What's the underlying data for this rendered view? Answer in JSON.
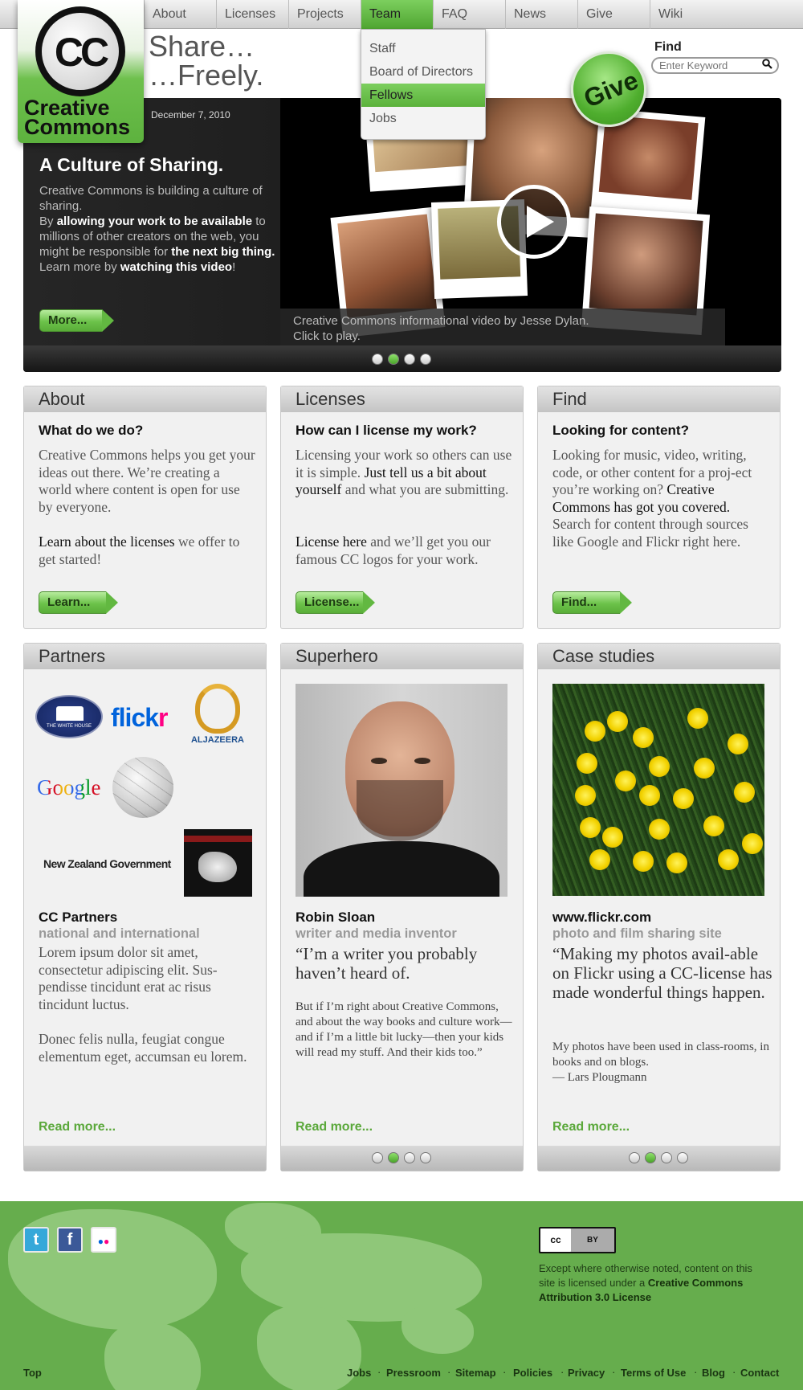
{
  "nav": {
    "items": [
      {
        "label": "About"
      },
      {
        "label": "Licenses"
      },
      {
        "label": "Projects"
      },
      {
        "label": "Team"
      },
      {
        "label": "FAQ"
      },
      {
        "label": "News"
      },
      {
        "label": "Give"
      },
      {
        "label": "Wiki"
      }
    ],
    "active": "Team",
    "active_color": "#5bb23b"
  },
  "logo": {
    "mark": "CC",
    "line1": "Creative",
    "line2": "Commons"
  },
  "tagline": {
    "line1": "Share…",
    "line2": "…Freely."
  },
  "team_menu": {
    "items": [
      {
        "label": "Staff"
      },
      {
        "label": "Board of Directors"
      },
      {
        "label": "Fellows"
      },
      {
        "label": "Jobs"
      }
    ],
    "highlighted": "Fellows"
  },
  "search": {
    "label": "Find",
    "placeholder": "Enter Keyword",
    "icon": "search-icon"
  },
  "give_badge": {
    "label": "Give"
  },
  "hero": {
    "date": "December 7, 2010",
    "title": "A Culture of Sharing.",
    "body": {
      "p1": "Creative Commons is building a culture of sharing.",
      "p2_pre": "By ",
      "p2_bold": "allowing your work to be available",
      "p2_mid": " to millions of other creators on the web, you might be responsible for ",
      "p2_bold2": "the next big thing.",
      "p3_pre": "Learn more by ",
      "p3_bold": "watching this video",
      "p3_post": "!"
    },
    "button": "More...",
    "video_caption_1": "Creative Commons informational video by Jesse Dylan.",
    "video_caption_2": "Click to play.",
    "pager": {
      "count": 4,
      "active_index": 1
    }
  },
  "panels_row1": [
    {
      "heading": "About",
      "subheading": "What do we do?",
      "body": "Creative Commons helps you get your ideas out there. We’re creating a world where content is open for use by everyone.",
      "body2_bold": "Learn about the licenses",
      "body2_rest": " we offer to get started!",
      "button": "Learn..."
    },
    {
      "heading": "Licenses",
      "subheading": "How can I license my work?",
      "body_pre": "Licensing your work so others can use it is simple. ",
      "body_bold": "Just tell us a bit about yourself",
      "body_post": " and what you are submitting.",
      "body2_bold": "License here",
      "body2_rest": " and we’ll get you our famous CC logos for your work.",
      "button": "License..."
    },
    {
      "heading": "Find",
      "subheading": "Looking for content?",
      "body_pre": "Looking for music, video, writing, code, or other content for a proj-ect you’re working on? ",
      "body_bold": "Creative Commons has got you covered.",
      "body_post": " Search for content through sources like Google and Flickr right here.",
      "button": "Find..."
    }
  ],
  "partners": {
    "heading": "Partners",
    "logos": {
      "whitehouse": "THE WHITE HOUSE",
      "flickr_a": "flick",
      "flickr_b": "r",
      "aljazeera": "ALJAZEERA",
      "google": "Google",
      "nz": "New Zealand Government"
    },
    "name": "CC Partners",
    "role": "national and international",
    "body": "Lorem ipsum dolor sit amet, consectetur adipiscing elit. Sus-pendisse tincidunt erat ac risus tincidunt luctus.",
    "body2": "Donec felis nulla, feugiat congue elementum eget, accumsan eu lorem.",
    "read_more": "Read more..."
  },
  "superhero": {
    "heading": "Superhero",
    "name": "Robin Sloan",
    "role": "writer and media inventor",
    "quote": "“I’m a writer you probably haven’t heard of.",
    "quote_small": "But if I’m right about Creative Commons, and about the way books and culture work—and if I’m a little bit lucky—then your kids will read my stuff. And their kids too.”",
    "read_more": "Read more...",
    "pager": {
      "count": 4,
      "active_index": 1
    }
  },
  "case_studies": {
    "heading": "Case studies",
    "name": "www.flickr.com",
    "role": "photo and film sharing site",
    "quote": "“Making my photos avail-able on Flickr using a CC-license has made wonderful things happen.",
    "quote_small": "My photos have been used in class-rooms, in books and on blogs.",
    "attribution": "— Lars Plougmann",
    "read_more": "Read more...",
    "pager": {
      "count": 4,
      "active_index": 1
    }
  },
  "footer": {
    "social": [
      {
        "name": "twitter-icon",
        "glyph": "t",
        "color": "#35a8d9"
      },
      {
        "name": "facebook-icon",
        "glyph": "f",
        "color": "#3b5998"
      },
      {
        "name": "flickr-icon",
        "glyph": "●●",
        "color": "#ffffff"
      }
    ],
    "badge_left": "cc",
    "badge_right": "BY",
    "license_pre": "Except where otherwise noted, content on this site is licensed under a ",
    "license_bold": "Creative Commons Attribution 3.0 License",
    "top_link": "Top",
    "links": [
      {
        "label": "Jobs"
      },
      {
        "label": "Pressroom"
      },
      {
        "label": "Sitemap"
      },
      {
        "label": "Policies"
      },
      {
        "label": "Privacy"
      },
      {
        "label": "Terms of Use"
      },
      {
        "label": "Blog"
      },
      {
        "label": "Contact"
      }
    ],
    "separator": "·",
    "background": "#66ad4d"
  }
}
